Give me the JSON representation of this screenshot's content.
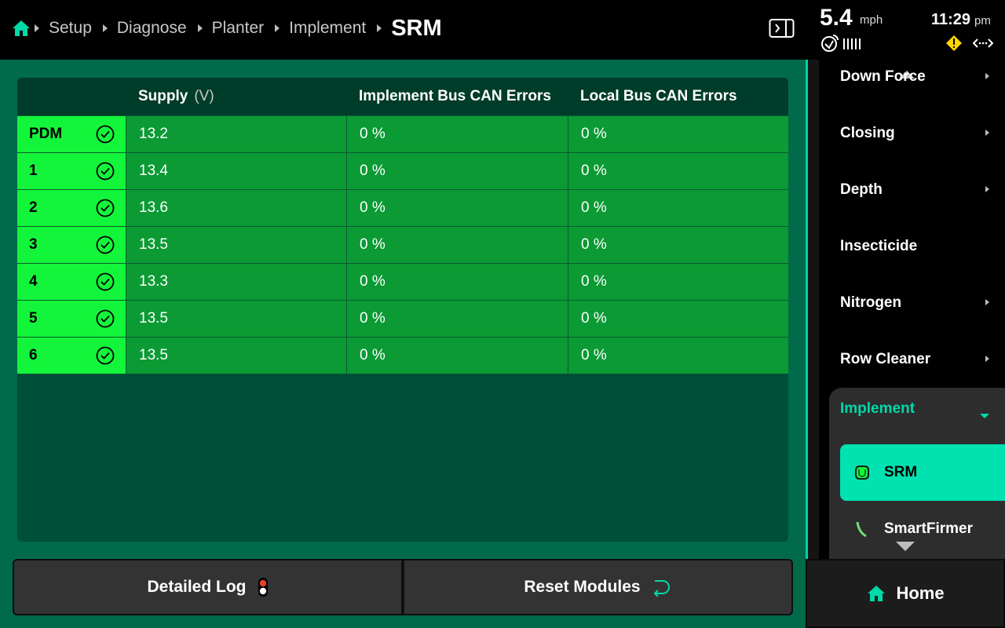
{
  "breadcrumb": {
    "items": [
      "Setup",
      "Diagnose",
      "Planter",
      "Implement"
    ],
    "current": "SRM"
  },
  "status": {
    "speed": "5.4",
    "speed_unit": "mph",
    "time": "11:29",
    "ampm": "pm"
  },
  "table": {
    "headers": {
      "supply": "Supply",
      "supply_unit": "(V)",
      "impl_bus": "Implement Bus CAN Errors",
      "local_bus": "Local Bus CAN Errors"
    },
    "rows": [
      {
        "module": "PDM",
        "supply": "13.2",
        "impl": "0 %",
        "local": "0 %"
      },
      {
        "module": "1",
        "supply": "13.4",
        "impl": "0 %",
        "local": "0 %"
      },
      {
        "module": "2",
        "supply": "13.6",
        "impl": "0 %",
        "local": "0 %"
      },
      {
        "module": "3",
        "supply": "13.5",
        "impl": "0 %",
        "local": "0 %"
      },
      {
        "module": "4",
        "supply": "13.3",
        "impl": "0 %",
        "local": "0 %"
      },
      {
        "module": "5",
        "supply": "13.5",
        "impl": "0 %",
        "local": "0 %"
      },
      {
        "module": "6",
        "supply": "13.5",
        "impl": "0 %",
        "local": "0 %"
      }
    ]
  },
  "buttons": {
    "detailed_log": "Detailed Log",
    "reset_modules": "Reset Modules"
  },
  "sidebar": {
    "items": [
      {
        "label": "Down Force"
      },
      {
        "label": "Closing"
      },
      {
        "label": "Depth"
      },
      {
        "label": "Insecticide"
      },
      {
        "label": "Nitrogen"
      },
      {
        "label": "Row Cleaner"
      }
    ],
    "group": {
      "label": "Implement",
      "items": [
        {
          "label": "SRM"
        },
        {
          "label": "SmartFirmer"
        }
      ]
    }
  },
  "home_button": "Home",
  "colors": {
    "accent": "#00e3b0",
    "main_bg": "#006a4a",
    "row_bg": "#0b9a34",
    "module_cell": "#13f53a"
  }
}
